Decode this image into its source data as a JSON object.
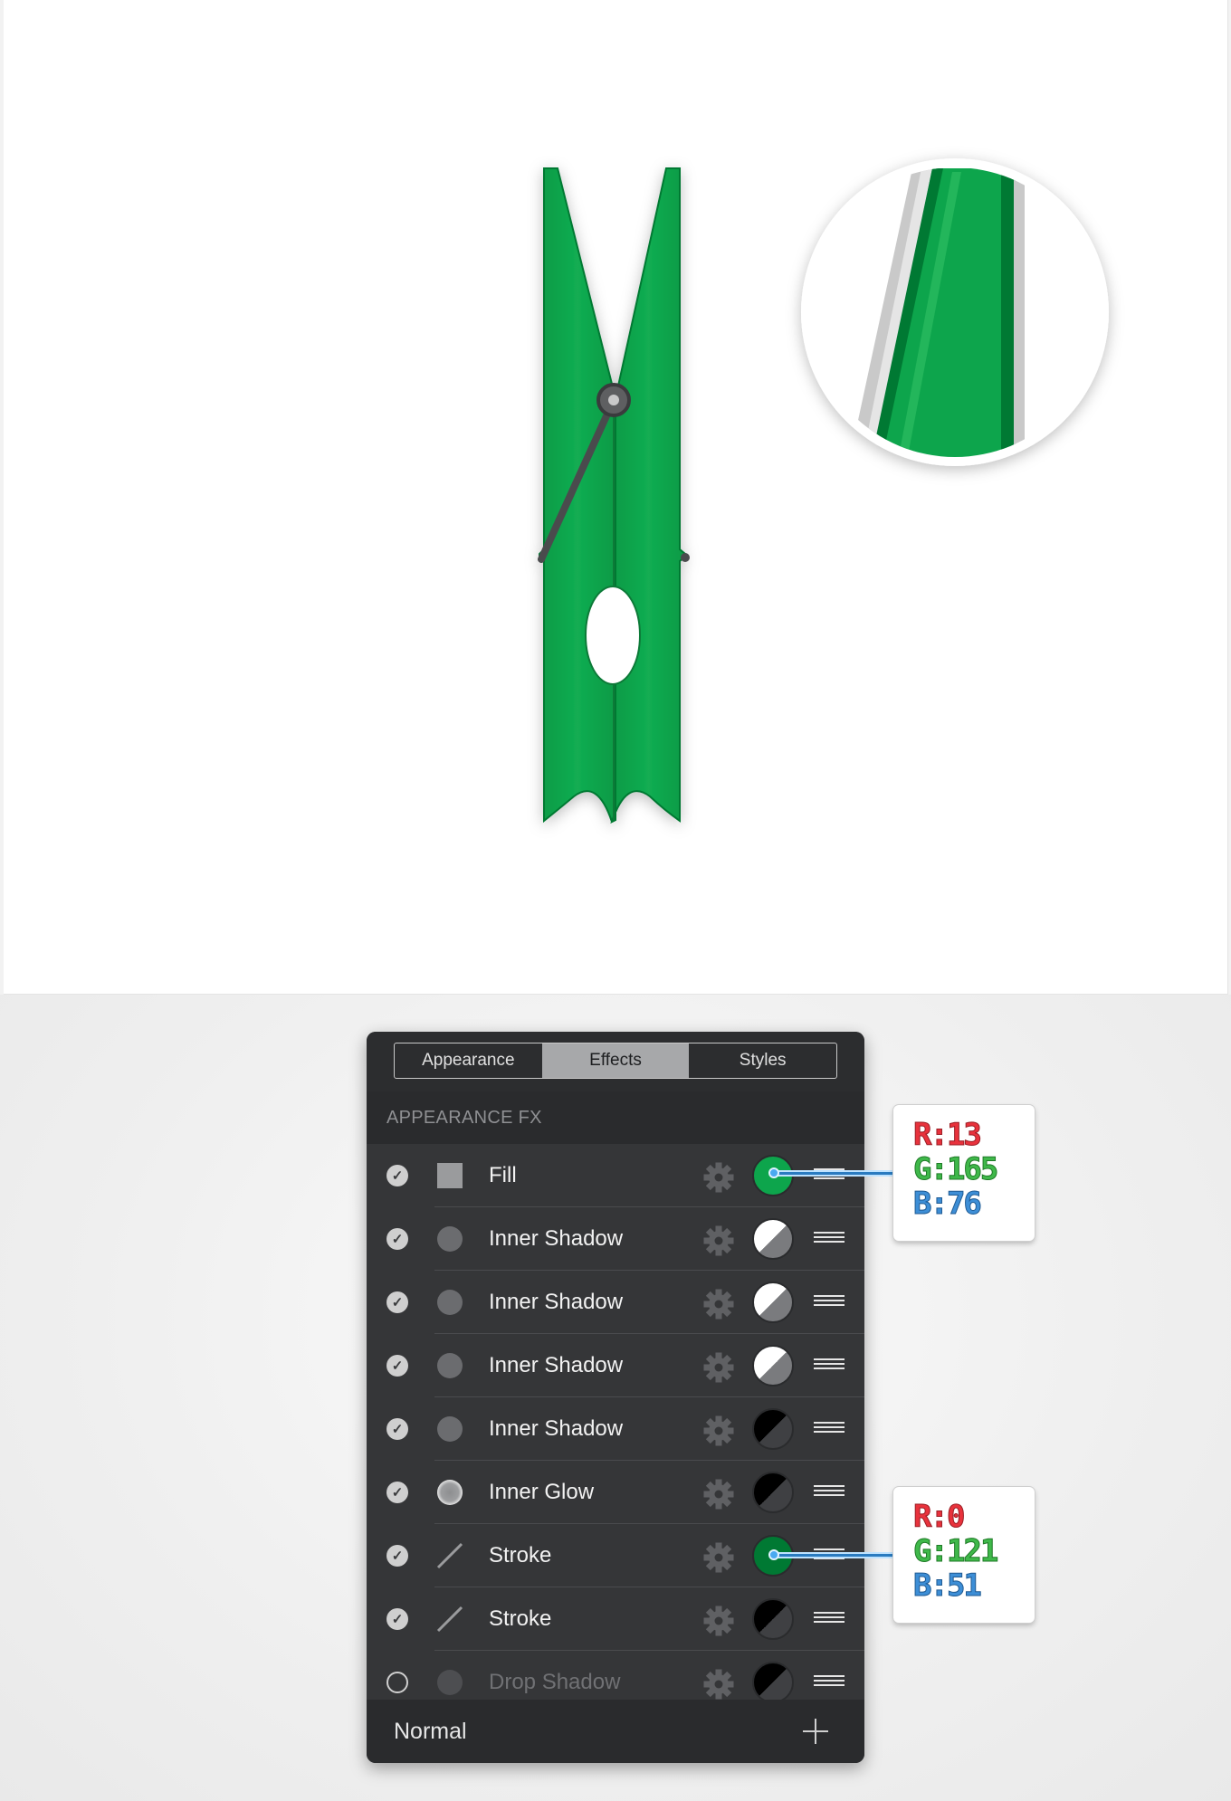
{
  "panel": {
    "tabs": [
      {
        "label": "Appearance",
        "active": false
      },
      {
        "label": "Effects",
        "active": true
      },
      {
        "label": "Styles",
        "active": false
      }
    ],
    "section_title": "APPEARANCE FX",
    "rows": [
      {
        "label": "Fill",
        "checked": true,
        "icon": "square-icon",
        "swatch": "#0da54c"
      },
      {
        "label": "Inner Shadow",
        "checked": true,
        "icon": "circle-icon",
        "swatch": "white-grey-split"
      },
      {
        "label": "Inner Shadow",
        "checked": true,
        "icon": "circle-icon",
        "swatch": "white-grey-split"
      },
      {
        "label": "Inner Shadow",
        "checked": true,
        "icon": "circle-icon",
        "swatch": "white-grey-split"
      },
      {
        "label": "Inner Shadow",
        "checked": true,
        "icon": "circle-icon",
        "swatch": "black-grey-split"
      },
      {
        "label": "Inner Glow",
        "checked": true,
        "icon": "glow-icon",
        "swatch": "black-grey-split"
      },
      {
        "label": "Stroke",
        "checked": true,
        "icon": "line-icon",
        "swatch": "#007933"
      },
      {
        "label": "Stroke",
        "checked": true,
        "icon": "line-icon",
        "swatch": "black-grey-split"
      },
      {
        "label": "Drop Shadow",
        "checked": false,
        "icon": "circle-icon",
        "swatch": "black-grey-split"
      }
    ],
    "blend_mode": "Normal"
  },
  "callouts": [
    {
      "r": "R:13",
      "g": "G:165",
      "b": "B:76"
    },
    {
      "r": "R:0",
      "g": "G:121",
      "b": "B:51"
    }
  ],
  "colors": {
    "fill": "#0da54c",
    "stroke": "#007933",
    "panel_bg": "#353638"
  }
}
